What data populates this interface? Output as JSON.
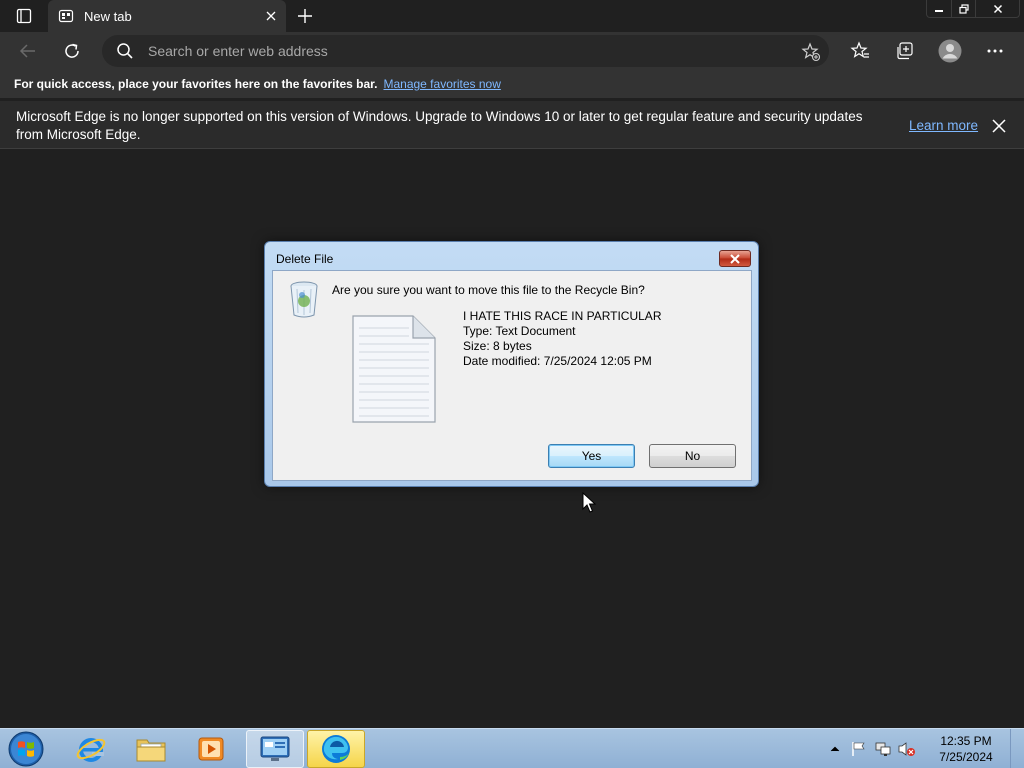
{
  "browser": {
    "tab_title": "New tab",
    "address_placeholder": "Search or enter web address",
    "favbar_message": "For quick access, place your favorites here on the favorites bar.",
    "favbar_link": "Manage favorites now",
    "infobar_message": "Microsoft Edge is no longer supported on this version of Windows. Upgrade to Windows 10 or later to get regular feature and security updates from Microsoft Edge.",
    "infobar_link": "Learn more",
    "icons": [
      "tab-actions-icon",
      "new-tab-page-icon",
      "close-icon",
      "plus-icon",
      "minimize-icon",
      "restore-icon",
      "back-icon",
      "refresh-icon",
      "search-icon",
      "add-favorite-icon",
      "favorites-icon",
      "collections-icon",
      "profile-icon",
      "more-icon"
    ]
  },
  "dialog": {
    "title": "Delete File",
    "question": "Are you sure you want to move this file to the Recycle Bin?",
    "file_name": "I HATE THIS RACE IN PARTICULAR",
    "file_type": "Type: Text Document",
    "file_size": "Size: 8 bytes",
    "file_modified": "Date modified: 7/25/2024 12:05 PM",
    "yes_label": "Yes",
    "no_label": "No"
  },
  "taskbar": {
    "apps": [
      "start-orb",
      "internet-explorer",
      "windows-explorer",
      "media-player",
      "control-panel",
      "microsoft-edge"
    ],
    "clock_time": "12:35 PM",
    "clock_date": "7/25/2024"
  },
  "colors": {
    "page_background": "#202020",
    "toolbar": "#333333",
    "link": "#7fb8ff",
    "taskbar": "#a8c4e0"
  }
}
